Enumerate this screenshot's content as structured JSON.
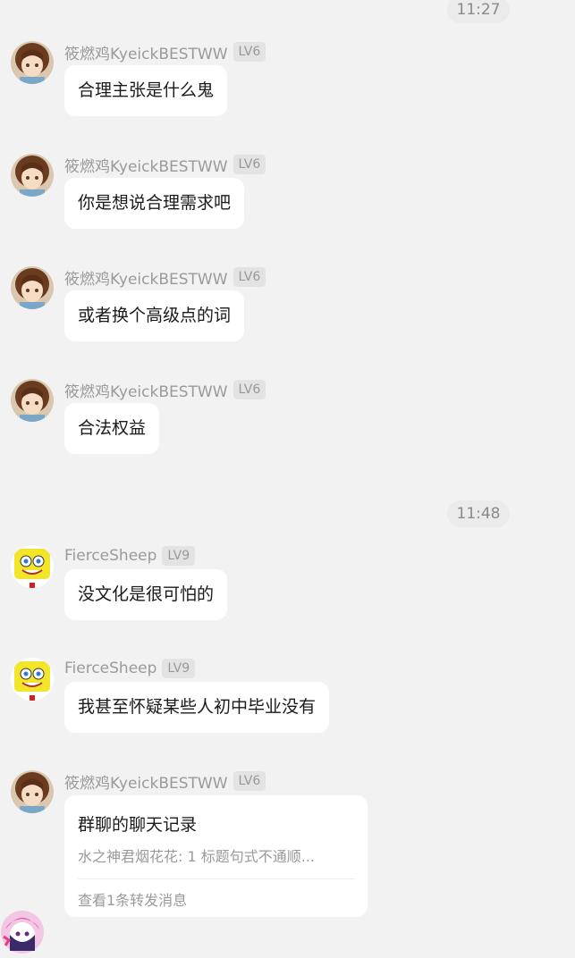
{
  "timestamps": [
    "11:27",
    "11:48"
  ],
  "users": {
    "kyeick": {
      "name": "筱燃鸡KyeickBESTWW",
      "level": "LV6",
      "avatar": "girl-avatar-icon"
    },
    "sheep": {
      "name": "FierceSheep",
      "level": "LV9",
      "avatar": "sponge-avatar-icon"
    }
  },
  "messages": [
    {
      "text": "合理主张是什么鬼"
    },
    {
      "text": "你是想说合理需求吧"
    },
    {
      "text": "或者换个高级点的词"
    },
    {
      "text": "合法权益"
    },
    {
      "text": "没文化是很可怕的"
    },
    {
      "text": "我甚至怀疑某些人初中毕业没有"
    }
  ],
  "forward": {
    "title": "群聊的聊天记录",
    "preview": "水之神君烟花花: 1 标题句式不通顺...",
    "footer": "查看1条转发消息"
  },
  "colors": {
    "background": "#f2f2f2",
    "bubble": "#ffffff",
    "muted_text": "#9a9a9a"
  }
}
